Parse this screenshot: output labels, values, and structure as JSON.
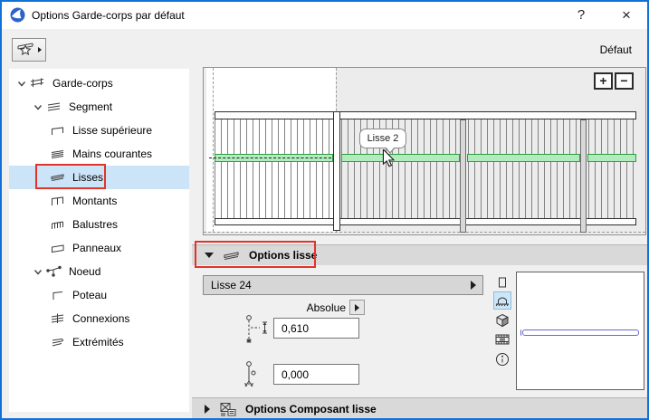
{
  "window": {
    "title": "Options Garde-corps par défaut",
    "help_label": "?",
    "close_label": "×",
    "default_label": "Défaut"
  },
  "sidebar": {
    "items": [
      {
        "label": "Garde-corps",
        "level": 0,
        "icon": "railing",
        "expanded": true,
        "selected": false,
        "annotated": false
      },
      {
        "label": "Segment",
        "level": 1,
        "icon": "segment",
        "expanded": true,
        "selected": false,
        "annotated": false
      },
      {
        "label": "Lisse supérieure",
        "level": 2,
        "icon": "top-rail",
        "expanded": null,
        "selected": false,
        "annotated": false
      },
      {
        "label": "Mains courantes",
        "level": 2,
        "icon": "handrail",
        "expanded": null,
        "selected": false,
        "annotated": false
      },
      {
        "label": "Lisses",
        "level": 2,
        "icon": "rails",
        "expanded": null,
        "selected": true,
        "annotated": true
      },
      {
        "label": "Montants",
        "level": 2,
        "icon": "inner-posts",
        "expanded": null,
        "selected": false,
        "annotated": false
      },
      {
        "label": "Balustres",
        "level": 2,
        "icon": "balusters",
        "expanded": null,
        "selected": false,
        "annotated": false
      },
      {
        "label": "Panneaux",
        "level": 2,
        "icon": "panels",
        "expanded": null,
        "selected": false,
        "annotated": false
      },
      {
        "label": "Noeud",
        "level": 1,
        "icon": "node",
        "expanded": true,
        "selected": false,
        "annotated": false
      },
      {
        "label": "Poteau",
        "level": 2,
        "icon": "post",
        "expanded": null,
        "selected": false,
        "annotated": false
      },
      {
        "label": "Connexions",
        "level": 2,
        "icon": "connections",
        "expanded": null,
        "selected": false,
        "annotated": false
      },
      {
        "label": "Extrémités",
        "level": 2,
        "icon": "ends",
        "expanded": null,
        "selected": false,
        "annotated": false
      }
    ]
  },
  "preview": {
    "tooltip": "Lisse 2",
    "zoom_in_label": "+",
    "zoom_out_label": "−"
  },
  "options_lisse": {
    "header": "Options lisse",
    "profile_name": "Lisse 24",
    "mode_label": "Absolue",
    "top_offset_value": "0,610",
    "bottom_offset_value": "0,000"
  },
  "options_composant": {
    "header": "Options Composant lisse"
  },
  "view_modes": [
    {
      "name": "plan-symbol",
      "selected": false
    },
    {
      "name": "elevation",
      "selected": true
    },
    {
      "name": "model-3d",
      "selected": false
    },
    {
      "name": "animation",
      "selected": false
    },
    {
      "name": "info",
      "selected": false
    }
  ],
  "colors": {
    "accent_border": "#1271d6",
    "selection_blue": "#cce4f7",
    "annotation_red": "#e1342a",
    "rail_green": "#2f9e44",
    "rail_green_fill": "#b2ecbc",
    "thumb_bar_blue": "#6a6ad2",
    "header_gray": "#d9d9d9"
  }
}
